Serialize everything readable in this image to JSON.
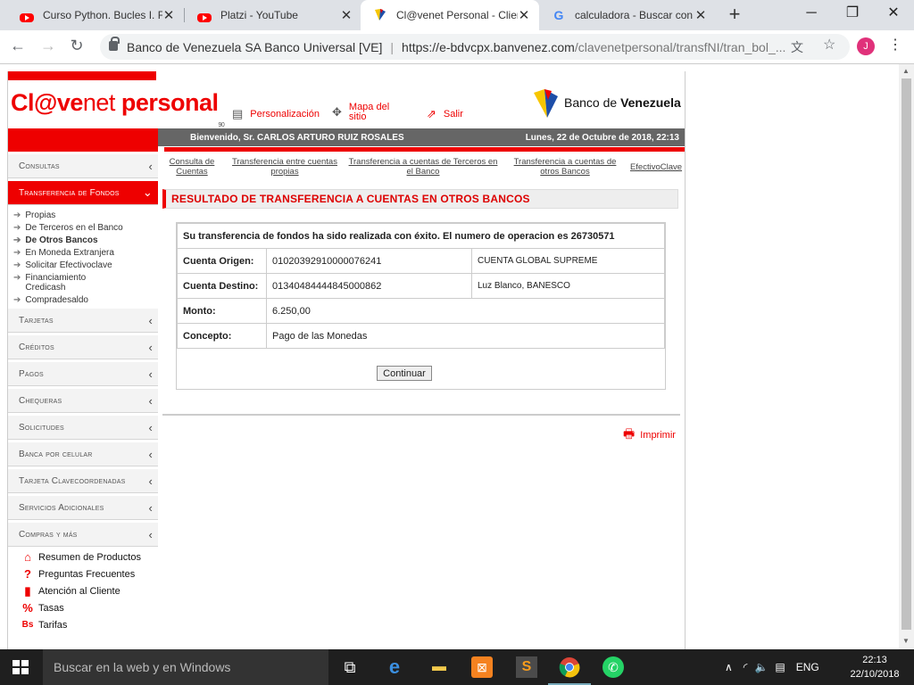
{
  "browser": {
    "tabs": [
      {
        "title": "Curso Python. Bucles I. Fo",
        "icon": "youtube-icon"
      },
      {
        "title": "Platzi - YouTube",
        "icon": "youtube-icon"
      },
      {
        "title": "Cl@venet Personal - Clien",
        "icon": "bdv-icon",
        "active": true
      },
      {
        "title": "calculadora - Buscar con",
        "icon": "google-icon"
      }
    ],
    "new_tab": "+",
    "window_controls": {
      "minimize": "─",
      "maximize": "❐",
      "close": "✕"
    },
    "address": {
      "site_name": "Banco de Venezuela SA Banco Universal [VE]",
      "url_host": "https://e-bdvcpx.banvenez.com",
      "url_path": "/clavenetpersonal/transfNI/tran_bol_..."
    },
    "profile_initial": "J",
    "menu": "⋮"
  },
  "header": {
    "logo_a": "Cl@ve",
    "logo_b": "net",
    "logo_c": " personal",
    "logo_sup": "90",
    "links": [
      {
        "label": "Personalización",
        "icon": "settings-icon"
      },
      {
        "label": "Mapa del sitio",
        "icon": "sitemap-icon"
      },
      {
        "label": "Salir",
        "icon": "exit-icon"
      }
    ],
    "bank_name_a": "Banco de ",
    "bank_name_b": "Venezuela",
    "welcome": "Bienvenido, Sr.  CARLOS ARTURO RUIZ ROSALES",
    "date": "Lunes, 22 de Octubre de 2018, 22:13"
  },
  "sidebar": {
    "menus_top": [
      {
        "label": "Consultas"
      },
      {
        "label": "Transferencia de Fondos",
        "active": true
      }
    ],
    "submenu": [
      {
        "label": "Propias"
      },
      {
        "label": "De Terceros en el Banco"
      },
      {
        "label": "De Otros Bancos",
        "bold": true
      },
      {
        "label": "En Moneda Extranjera"
      },
      {
        "label": "Solicitar Efectivoclave"
      },
      {
        "label": "Financiamiento Credicash"
      },
      {
        "label": "Compradesaldo"
      }
    ],
    "menus_bottom": [
      {
        "label": "Tarjetas"
      },
      {
        "label": "Créditos"
      },
      {
        "label": "Pagos"
      },
      {
        "label": "Chequeras"
      },
      {
        "label": "Solicitudes"
      },
      {
        "label": "Banca por celular"
      },
      {
        "label": "Tarjeta Clavecoordenadas"
      },
      {
        "label": "Servicios Adicionales"
      },
      {
        "label": "Compras y más"
      }
    ],
    "extras": [
      {
        "label": "Resumen de Productos",
        "icon": "home-icon"
      },
      {
        "label": "Preguntas Frecuentes",
        "icon": "question-icon"
      },
      {
        "label": "Atención al Cliente",
        "icon": "phone-icon"
      },
      {
        "label": "Tasas",
        "icon": "percent-icon"
      },
      {
        "label": "Tarifas",
        "icon": "fees-icon"
      }
    ]
  },
  "subnav": [
    "Consulta de Cuentas",
    "Transferencia entre cuentas propias",
    "Transferencia a cuentas de Terceros en el Banco",
    "Transferencia a cuentas de otros Bancos",
    "EfectivoClave"
  ],
  "main": {
    "section_title": "RESULTADO DE TRANSFERENCIA A CUENTAS EN OTROS BANCOS",
    "message": "Su transferencia de fondos ha sido realizada con éxito. El numero de operacion es 26730571",
    "rows": {
      "origen_label": "Cuenta Origen:",
      "origen_value": "01020392910000076241",
      "origen_desc": "CUENTA GLOBAL SUPREME",
      "destino_label": "Cuenta Destino:",
      "destino_value": "01340484444845000862",
      "destino_desc": "Luz Blanco, BANESCO",
      "monto_label": "Monto:",
      "monto_value": "6.250,00",
      "concepto_label": "Concepto:",
      "concepto_value": "Pago de las Monedas"
    },
    "continue_label": "Continuar",
    "print_label": "Imprimir"
  },
  "taskbar": {
    "search_placeholder": "Buscar en la web y en Windows",
    "lang": "ENG",
    "time": "22:13",
    "date": "22/10/2018"
  }
}
